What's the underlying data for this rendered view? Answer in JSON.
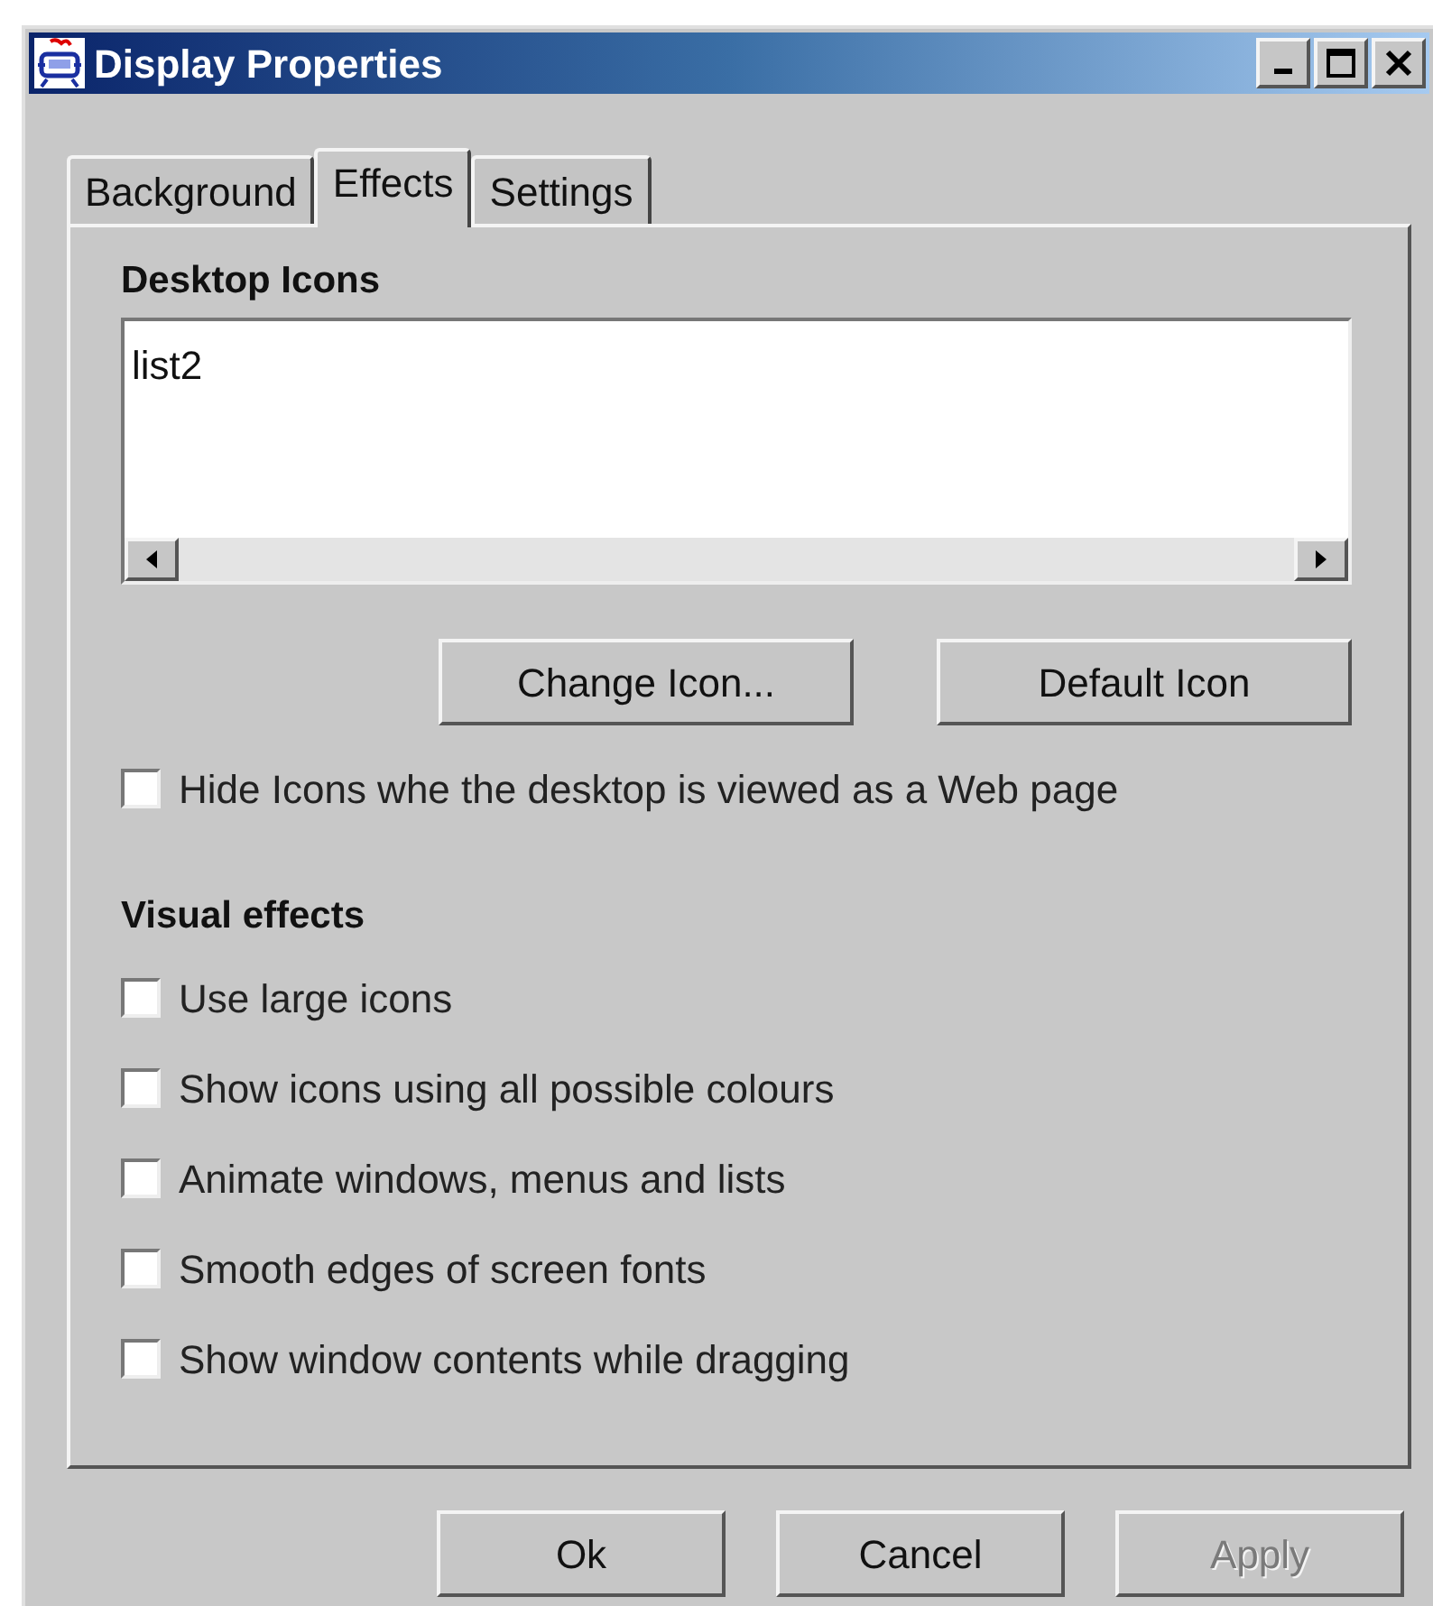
{
  "window": {
    "title": "Display Properties"
  },
  "tabs": [
    {
      "label": "Background",
      "selected": false
    },
    {
      "label": "Effects",
      "selected": true
    },
    {
      "label": "Settings",
      "selected": false
    }
  ],
  "desktop_icons": {
    "title": "Desktop Icons",
    "list_items": [
      "list2"
    ],
    "buttons": [
      {
        "label": "Change Icon...",
        "disabled": false
      },
      {
        "label": "Default Icon",
        "disabled": false
      }
    ],
    "option": {
      "label": "Hide Icons whe the desktop is viewed as a Web page",
      "checked": false
    }
  },
  "visual_effects": {
    "title": "Visual effects",
    "options": [
      {
        "label": "Use large icons",
        "checked": false
      },
      {
        "label": "Show icons using all possible colours",
        "checked": false
      },
      {
        "label": "Animate windows, menus and lists",
        "checked": false
      },
      {
        "label": "Smooth edges of screen fonts",
        "checked": false
      },
      {
        "label": "Show window contents while dragging",
        "checked": false
      }
    ]
  },
  "buttons": [
    {
      "label": "Ok",
      "disabled": false
    },
    {
      "label": "Cancel",
      "disabled": false
    },
    {
      "label": "Apply",
      "disabled": true
    }
  ]
}
